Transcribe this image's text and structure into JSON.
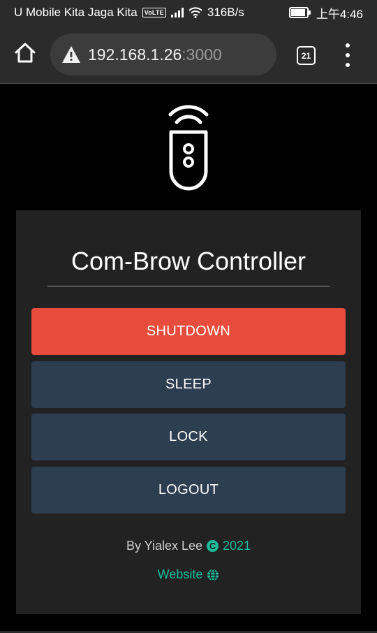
{
  "status_bar": {
    "carrier": "U Mobile Kita Jaga Kita",
    "volte": "VoLTE",
    "speed": "316B/s",
    "battery_level": 0.85,
    "time": "上午4:46"
  },
  "browser": {
    "url_host": "192.168.1.26",
    "url_port": ":3000",
    "tab_count": "21"
  },
  "app": {
    "title": "Com-Brow Controller",
    "buttons": [
      {
        "label": "SHUTDOWN"
      },
      {
        "label": "SLEEP"
      },
      {
        "label": "LOCK"
      },
      {
        "label": "LOGOUT"
      }
    ],
    "credit_prefix": "By Yialex Lee",
    "credit_year": "2021",
    "website_label": "Website"
  },
  "colors": {
    "danger": "#e74c3c",
    "button": "#2c3e50",
    "accent": "#1abc9c",
    "card": "#222222"
  },
  "icons": [
    "home-icon",
    "warning-icon",
    "tab-switcher-icon",
    "overflow-menu-icon",
    "remote-control-icon",
    "copyright-icon",
    "globe-icon"
  ]
}
